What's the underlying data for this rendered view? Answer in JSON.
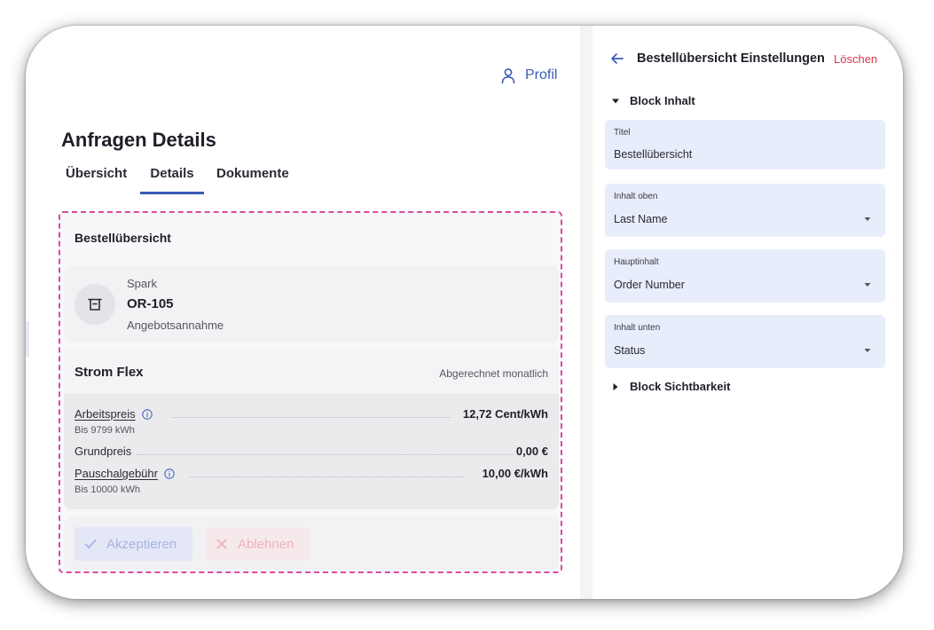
{
  "header": {
    "profile_label": "Profil"
  },
  "page": {
    "title": "Anfragen Details",
    "tabs": [
      {
        "label": "Übersicht",
        "active": false
      },
      {
        "label": "Details",
        "active": true
      },
      {
        "label": "Dokumente",
        "active": false
      }
    ]
  },
  "order_block": {
    "title": "Bestellübersicht",
    "order": {
      "supplier": "Spark",
      "number": "OR-105",
      "status": "Angebotsannahme"
    },
    "tariff": {
      "name": "Strom Flex",
      "billing": "Abgerechnet monatlich",
      "prices": [
        {
          "name": "Arbeitspreis",
          "value": "12,72 Cent/kWh",
          "note": "Bis 9799 kWh",
          "info_icon": "info-icon"
        },
        {
          "name": "Grundpreis",
          "value": "0,00 €"
        },
        {
          "name": "Pauschalgebühr",
          "value": "10,00 €/kWh",
          "note": "Bis 10000 kWh",
          "info_icon": "info-icon"
        }
      ]
    },
    "actions": {
      "accept_label": "Akzeptieren",
      "reject_label": "Ablehnen"
    }
  },
  "settings": {
    "title": "Bestellübersicht Einstellungen",
    "delete_label": "Löschen",
    "section_content": {
      "label": "Block Inhalt",
      "expanded": true
    },
    "fields": {
      "title": {
        "label": "Titel",
        "value": "Bestellübersicht"
      },
      "content_top": {
        "label": "Inhalt oben",
        "value": "Last Name"
      },
      "main_content": {
        "label": "Hauptinhalt",
        "value": "Order Number"
      },
      "content_bottom": {
        "label": "Inhalt unten",
        "value": "Status"
      }
    },
    "section_visibility": {
      "label": "Block Sichtbarkeit",
      "expanded": false
    }
  },
  "colors": {
    "accent": "#3b5bb5",
    "highlight_border": "#d94aa0",
    "delete": "#d8384a",
    "field_background": "#e8edfb",
    "accept_disabled": "#a8b4e4",
    "reject_disabled": "#eeb1bd"
  }
}
